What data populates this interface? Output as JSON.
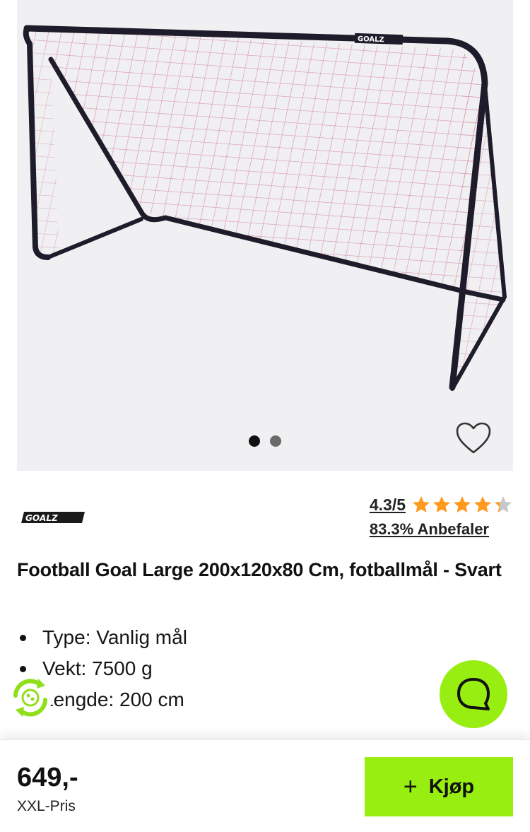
{
  "product": {
    "brand_logo_text": "GOALZ",
    "image_dots": 2,
    "active_image": 0,
    "title": "Football Goal Large 200x120x80 Cm, fotballmål - Svart",
    "specs": [
      {
        "text": "Type: Vanlig mål"
      },
      {
        "text": "Vekt: 7500 g"
      },
      {
        "text": "Lengde: 200 cm"
      }
    ]
  },
  "rating": {
    "score_text": "4.3/5",
    "value": 4.3,
    "max": 5,
    "recommend_text": "83.3% Anbefaler"
  },
  "purchase": {
    "price": "649,-",
    "price_label": "XXL-Pris",
    "buy_label": "Kjøp"
  },
  "icons": {
    "favorite": "heart-outline-icon",
    "chat": "chat-bubble-icon",
    "eco": "recycle-badge-icon",
    "buy": "plus-icon"
  },
  "colors": {
    "accent": "#99ee11",
    "star": "#ff9a1f",
    "gallery_bg": "#f0f0f2"
  }
}
